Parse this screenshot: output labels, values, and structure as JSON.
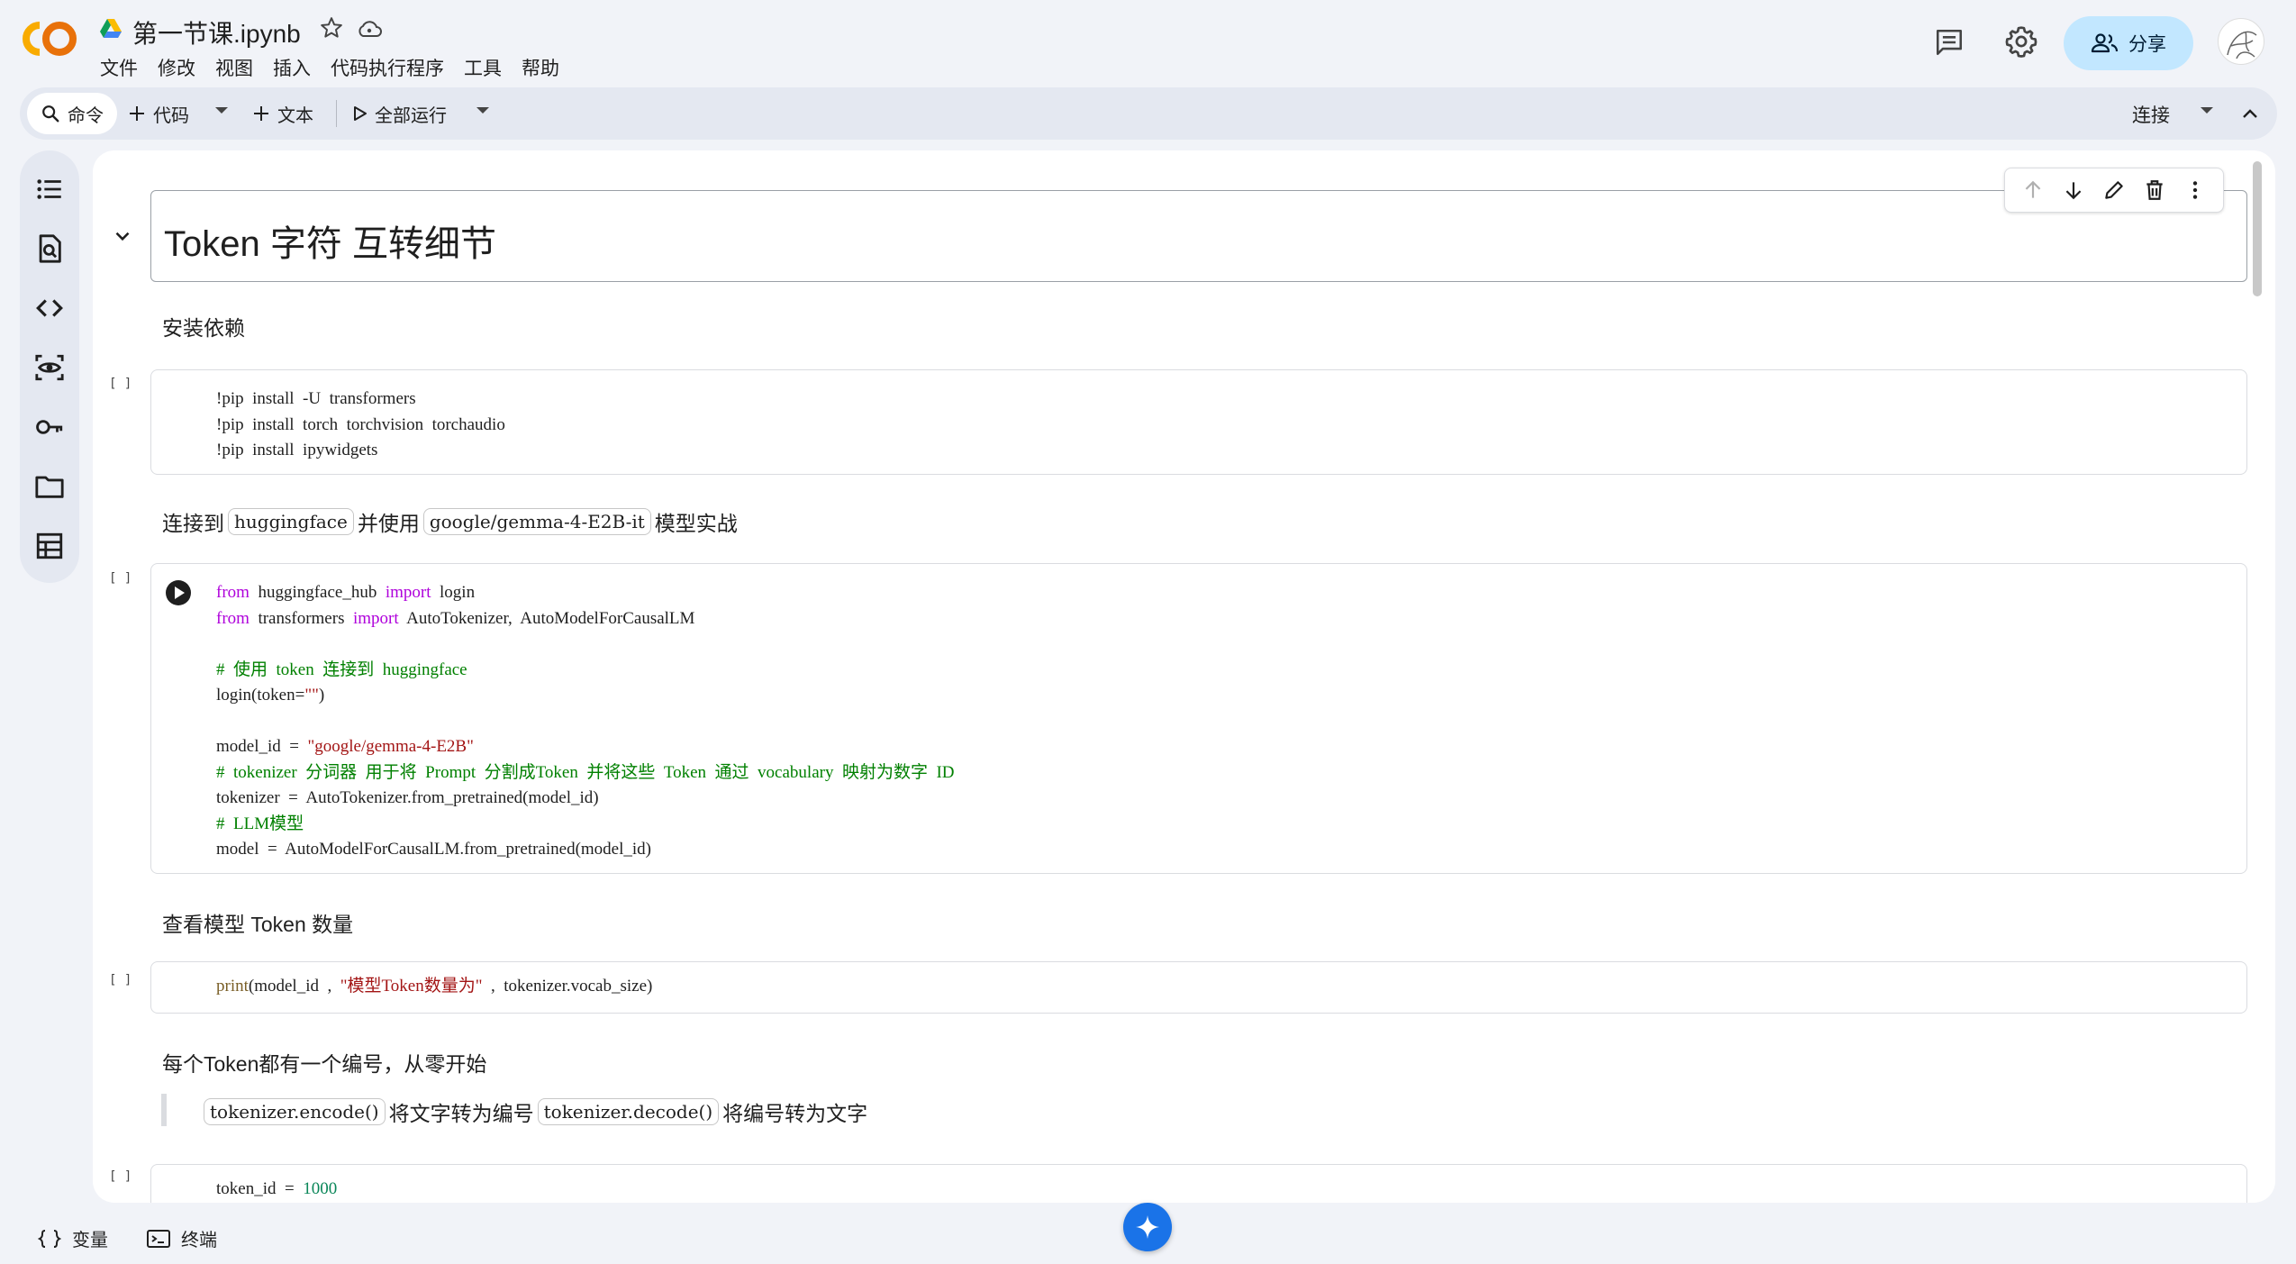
{
  "header": {
    "app_logo": "CO",
    "doc_title": "第一节课.ipynb",
    "menu": [
      "文件",
      "修改",
      "视图",
      "插入",
      "代码执行程序",
      "工具",
      "帮助"
    ],
    "share_label": "分享",
    "accent": "#c2e7ff"
  },
  "toolbar": {
    "command_label": "命令",
    "code_label": "代码",
    "text_label": "文本",
    "run_all_label": "全部运行",
    "connect_label": "连接"
  },
  "sidebar_icons": [
    "table-of-contents-icon",
    "find-replace-icon",
    "code-snippets-icon",
    "variables-inspector-icon",
    "secrets-key-icon",
    "files-folder-icon",
    "data-table-icon"
  ],
  "cells": {
    "title": "Token 字符 互转细节",
    "md1": "安装依赖",
    "exec_empty": "[ ]",
    "code1": {
      "l1": "!pip  install  -U  transformers",
      "l2": "!pip  install  torch  torchvision  torchaudio",
      "l3": "!pip  install  ipywidgets"
    },
    "md2": {
      "p1": "连接到",
      "c1": "huggingface",
      "p2": "并使用",
      "c2": "google/gemma-4-E2B-it",
      "p3": "模型实战"
    },
    "code2": {
      "l1_from": "from",
      "l1_mod": "  huggingface_hub  ",
      "l1_import": "import",
      "l1_rest": "  login",
      "l2_from": "from",
      "l2_mod": "  transformers  ",
      "l2_import": "import",
      "l2_rest": "  AutoTokenizer,  AutoModelForCausalLM",
      "l4": "#  使用  token  连接到  huggingface",
      "l5_a": "login(token=",
      "l5_s": "\"\"",
      "l5_b": ")",
      "l7_a": "model_id  =  ",
      "l7_s": "\"google/gemma-4-E2B\"",
      "l8": "#  tokenizer  分词器  用于将  Prompt  分割成Token  并将这些  Token  通过  vocabulary  映射为数字  ID",
      "l9": "tokenizer  =  AutoTokenizer.from_pretrained(model_id)",
      "l10": "#  LLM模型",
      "l11": "model  =  AutoModelForCausalLM.from_pretrained(model_id)"
    },
    "md3": "查看模型 Token 数量",
    "code3": {
      "fn": "print",
      "a": "(model_id  ,  ",
      "s": "\"模型Token数量为\"",
      "b": "  ,  tokenizer.vocab_size)"
    },
    "md4": "每个Token都有一个编号，从零开始",
    "md5": {
      "c1": "tokenizer.encode()",
      "p1": "将文字转为编号",
      "c2": "tokenizer.decode()",
      "p2": "将编号转为文字"
    },
    "code4": {
      "a": "token_id  =  ",
      "n": "1000"
    }
  },
  "bottom": {
    "variables_label": "变量",
    "terminal_label": "终端"
  }
}
